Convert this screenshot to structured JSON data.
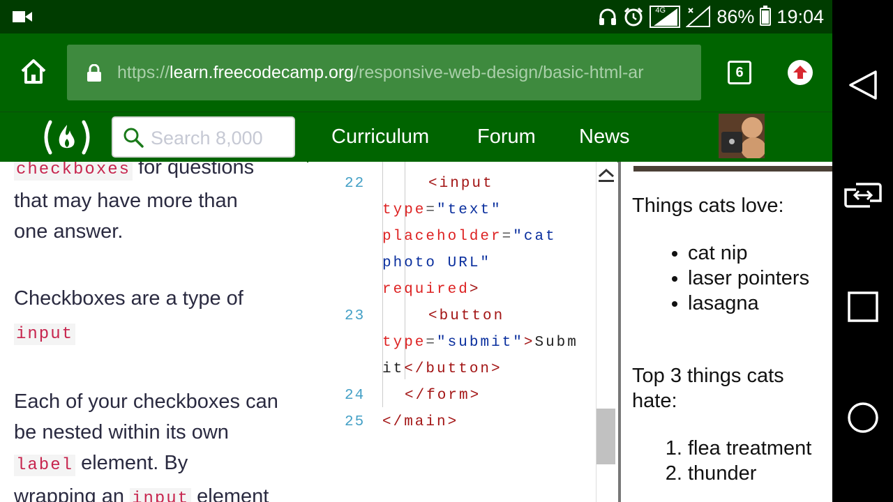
{
  "status_bar": {
    "network_label": "4G",
    "battery_percent": "86%",
    "battery_level": 0.86,
    "time": "19:04",
    "icons": [
      "video-camera-icon",
      "headphones-icon",
      "alarm-icon",
      "signal-4g-icon",
      "signal-icon",
      "battery-icon"
    ]
  },
  "browser": {
    "url_scheme": "https://",
    "url_host": "learn.freecodecamp.org",
    "url_path": "/responsive-web-design/basic-html-ar",
    "tab_count": "6"
  },
  "fcc_nav": {
    "logo_text": "(🔥)",
    "search_placeholder": "Search 8,000",
    "links": [
      "Curriculum",
      "Forum",
      "News"
    ]
  },
  "lesson": {
    "p1_code": "checkboxes",
    "p1_text_a": " for questions",
    "p1_text_b": "that may have more than",
    "p1_text_c": "one answer.",
    "p2_text": "Checkboxes are a type of",
    "p2_code": "input",
    "p3_text_a": "Each of your checkboxes can",
    "p3_text_b": "be nested within its own",
    "p3_code": "label",
    "p3_text_c": " element. By",
    "p4_text_a": "wrapping an ",
    "p4_code": "input",
    "p4_text_b": " element"
  },
  "editor": {
    "line_numbers": [
      "22",
      "23",
      "24",
      "25"
    ],
    "l22_tag": "<input",
    "l22_attr1": "type",
    "l22_val1": "\"text\"",
    "l22_attr2": "placeholder",
    "l22_val2a": "\"cat",
    "l22_val2b": "photo URL\"",
    "l22_attr3": "required",
    "l23_tag": "<button",
    "l23_attr": "type",
    "l23_val": "\"submit\"",
    "l23_text_a": "Subm",
    "l23_text_b": "it",
    "l23_close": "</button>",
    "l24": "</form>",
    "l25": "</main>"
  },
  "preview": {
    "heading1": "Things cats love:",
    "love_items": [
      "cat nip",
      "laser pointers",
      "lasagna"
    ],
    "heading2": "Top 3 things cats hate:",
    "hate_items": [
      "flea treatment",
      "thunder"
    ]
  },
  "colors": {
    "status_bg": "#003c00",
    "toolbar_bg": "#006400",
    "urlbar_bg": "#3e8a3e",
    "code_pink": "#c7254e",
    "line_number": "#44a0c6"
  }
}
